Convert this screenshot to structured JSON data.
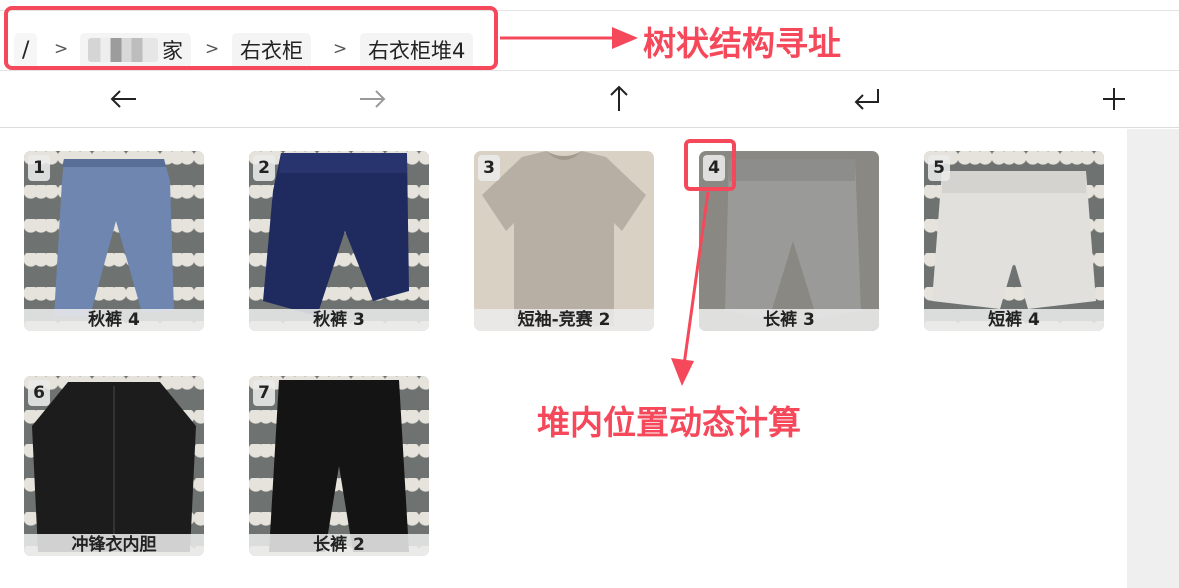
{
  "breadcrumb": {
    "root": "/",
    "separator": ">",
    "items": [
      {
        "label": "家",
        "redacted": true
      },
      {
        "label": "右衣柜"
      },
      {
        "label": "右衣柜堆4"
      }
    ]
  },
  "toolbar": {
    "back_icon": "arrow-left-icon",
    "forward_icon": "arrow-right-icon",
    "up_icon": "arrow-up-icon",
    "return_icon": "return-icon",
    "add_icon": "plus-icon"
  },
  "items": [
    {
      "num": "1",
      "label": "秋裤 4",
      "color": "#6f86b0"
    },
    {
      "num": "2",
      "label": "秋裤 3",
      "color": "#1f2a5e"
    },
    {
      "num": "3",
      "label": "短袖-竞赛 2",
      "color": "#b7afa3"
    },
    {
      "num": "4",
      "label": "长裤 3",
      "color": "#9a9a98"
    },
    {
      "num": "5",
      "label": "短裤 4",
      "color": "#e1e0dd"
    },
    {
      "num": "6",
      "label": "冲锋衣内胆",
      "color": "#1c1c1c"
    },
    {
      "num": "7",
      "label": "长裤 2",
      "color": "#141414"
    }
  ],
  "annotations": {
    "tree_label": "树状结构寻址",
    "position_label": "堆内位置动态计算",
    "color": "#f5495b"
  }
}
